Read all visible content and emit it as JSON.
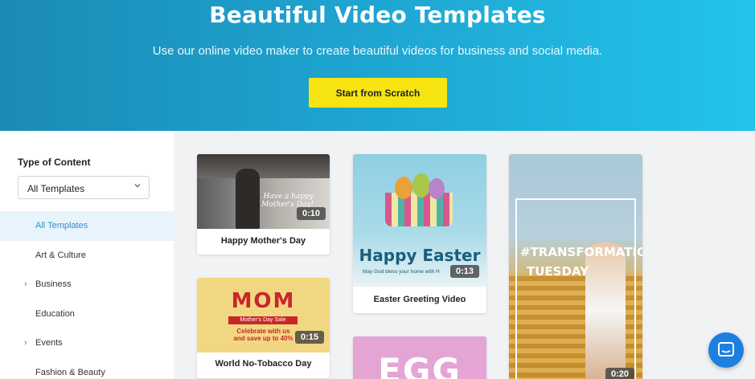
{
  "hero": {
    "title": "Beautiful Video Templates",
    "subtitle": "Use our online video maker to create beautiful videos for business and social media.",
    "cta_label": "Start from Scratch"
  },
  "sidebar": {
    "filter_title": "Type of Content",
    "select_value": "All Templates",
    "items": [
      {
        "label": "All Templates",
        "active": true,
        "expandable": false
      },
      {
        "label": "Art & Culture",
        "active": false,
        "expandable": false
      },
      {
        "label": "Business",
        "active": false,
        "expandable": true
      },
      {
        "label": "Education",
        "active": false,
        "expandable": false
      },
      {
        "label": "Events",
        "active": false,
        "expandable": true
      },
      {
        "label": "Fashion & Beauty",
        "active": false,
        "expandable": false
      }
    ]
  },
  "cards": {
    "mothers_day": {
      "title": "Happy Mother's Day",
      "duration": "0:10",
      "overlay_text": "Have a happy Mother's Day!"
    },
    "tobacco": {
      "title": "World No-Tobacco Day",
      "duration": "0:15",
      "headline": "MOM",
      "banner": "Mother's Day Sale",
      "promo_line1": "Celebrate with us",
      "promo_line2": "and save up to 40%"
    },
    "easter": {
      "title": "Easter Greeting Video",
      "duration": "0:13",
      "headline": "Happy Easter",
      "subline": "May God bless your home with H"
    },
    "transformation": {
      "duration": "0:20",
      "line1": "#TRANSFORMATION",
      "line2": "TUESDAY"
    },
    "egg": {
      "text": "EGG"
    }
  },
  "colors": {
    "accent": "#2f8fc9",
    "cta": "#f7e511",
    "chat": "#1d7fe0"
  }
}
